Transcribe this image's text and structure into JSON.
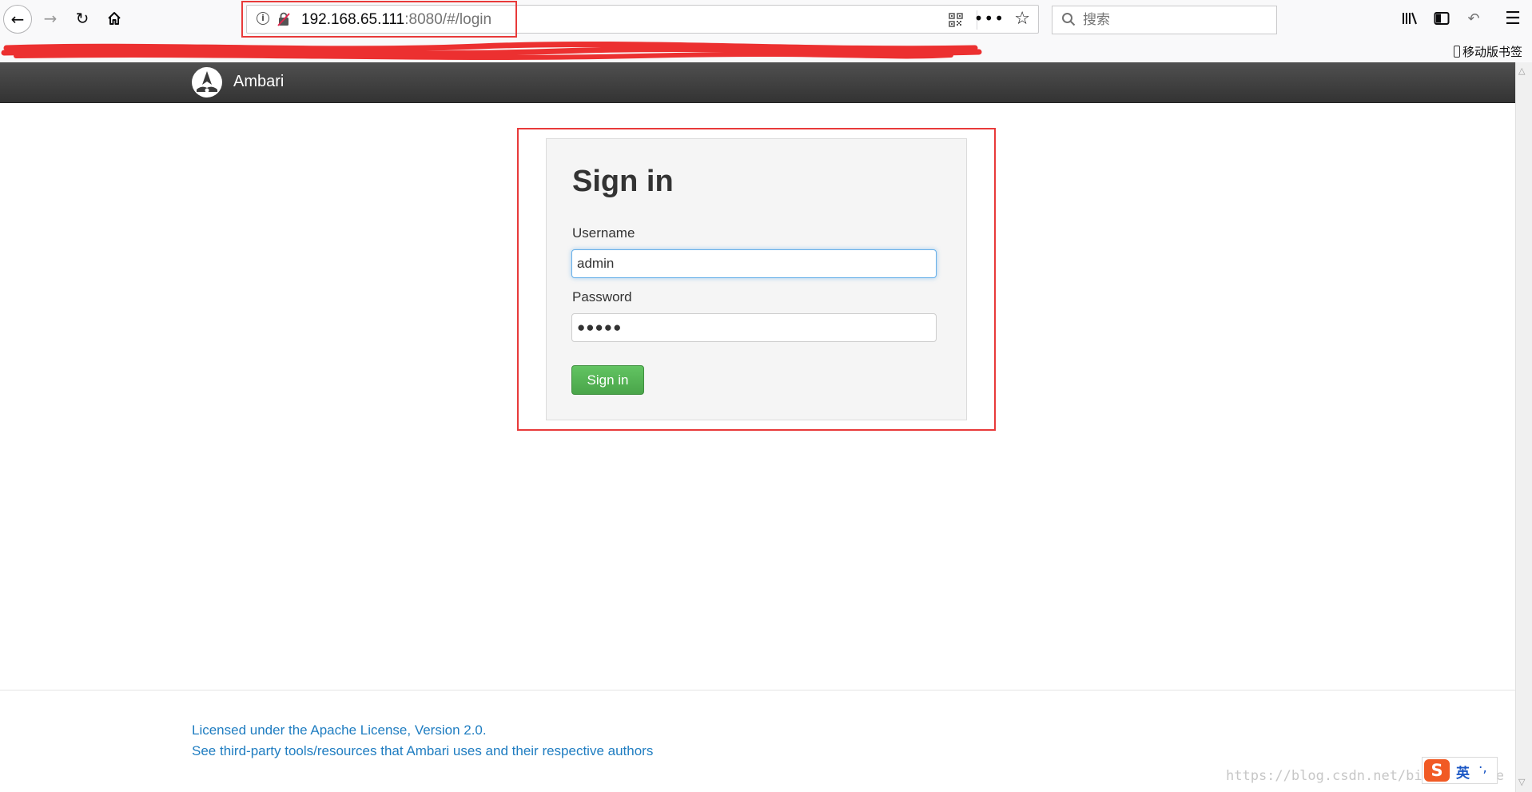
{
  "browser": {
    "url_host": "192.168.65.111",
    "url_rest": ":8080/#/login",
    "search_placeholder": "搜索",
    "mobile_bookmarks": "移动版书签"
  },
  "icons": {
    "back": "arrow-left-icon",
    "forward": "arrow-right-icon",
    "reload": "reload-icon",
    "home": "home-icon",
    "info": "info-icon",
    "insecure": "insecure-lock-icon",
    "qr": "qr-code-icon",
    "more": "more-icon",
    "bookmark": "star-icon",
    "search": "search-icon",
    "library": "library-icon",
    "sidebar": "sidebar-icon",
    "undo": "undo-icon",
    "menu": "hamburger-menu-icon"
  },
  "app": {
    "name": "Ambari"
  },
  "login": {
    "title": "Sign in",
    "username_label": "Username",
    "username_value": "admin",
    "password_label": "Password",
    "password_value": "●●●●●",
    "submit_label": "Sign in"
  },
  "footer": {
    "license_text": "Licensed under the Apache License, Version 2.0.",
    "thirdparty_text": "See third-party tools/resources that Ambari uses and their respective authors"
  },
  "overlay": {
    "watermark": "https://blog.csdn.net/bitcarmanlee",
    "ime_logo": "S",
    "ime_lang": "英",
    "ime_punct": "·,"
  },
  "colors": {
    "annotation_red": "#e83a3a",
    "signin_green": "#5cb85c",
    "link_blue": "#1f7dc1",
    "header_dark": "#3a3a3a"
  }
}
